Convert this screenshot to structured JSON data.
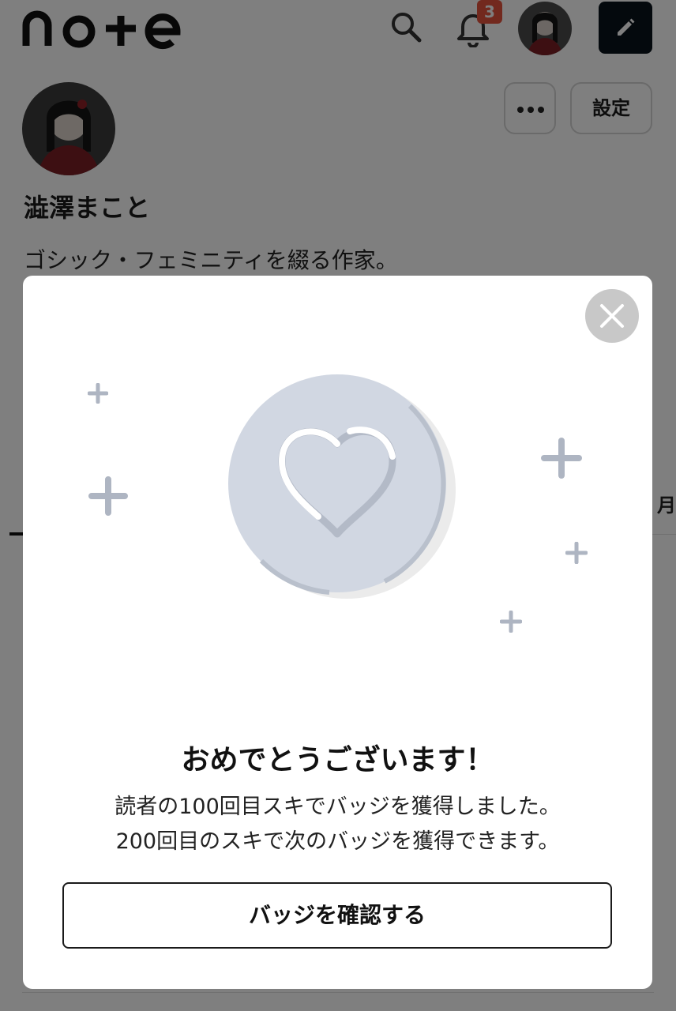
{
  "header": {
    "logo_text": "note",
    "notification_count": "3",
    "icons": [
      "search-icon",
      "bell-icon",
      "pencil-icon"
    ]
  },
  "profile": {
    "name": "澁澤まこと",
    "bio": "ゴシック・フェミニティを綴る作家。",
    "more_label": "•••",
    "settings_label": "設定",
    "tab_partial": "月"
  },
  "modal": {
    "title": "おめでとうございます！",
    "line1": "読者の100回目スキでバッジを獲得しました。",
    "line2": "200回目のスキで次のバッジを獲得できます。",
    "button_label": "バッジを確認する",
    "icons": [
      "close-icon",
      "heart-badge-icon",
      "sparkle-icon"
    ]
  },
  "colors": {
    "badge_red": "#e5533d",
    "write_button": "#08131a",
    "medal_fill": "#d1d7e2",
    "sparkle": "#aeb5c2"
  }
}
